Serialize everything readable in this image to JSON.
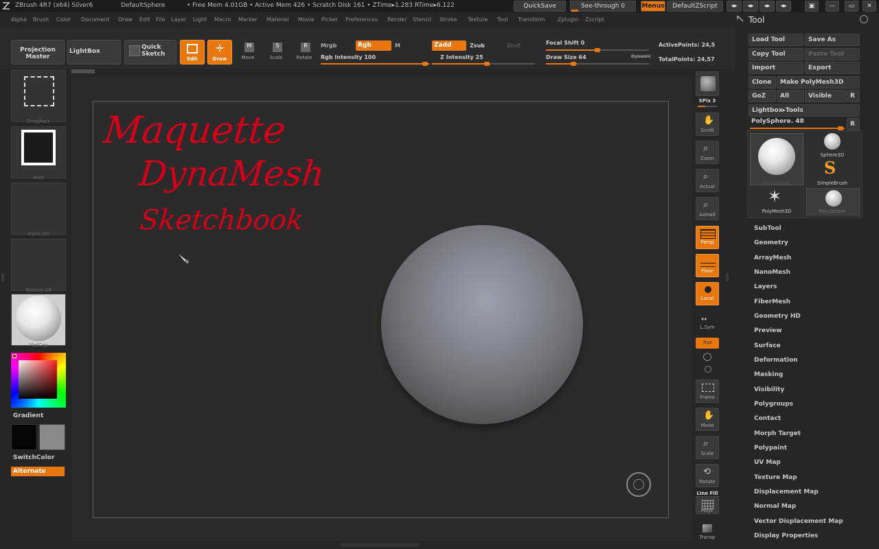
{
  "titlebar": {
    "app": "ZBrush 4R7 (x64) Silver6",
    "project": "DefaultSphere",
    "stats": "• Free Mem 4.01GB • Active Mem 426 • Scratch Disk 161 • ZTime▸1.283 RTime▸6.122",
    "quicksave": "QuickSave",
    "see_through": "See-through  0",
    "menus": "Menus",
    "default_zscript": "DefaultZScript"
  },
  "menus": [
    "Alpha",
    "Brush",
    "Color",
    "Document",
    "Draw",
    "Edit",
    "File",
    "Layer",
    "Light",
    "Macro",
    "Marker",
    "Material",
    "Movie",
    "Picker",
    "Preferences",
    "Render",
    "Stencil",
    "Stroke",
    "Texture",
    "Tool",
    "Transform",
    "Zplugin",
    "Zscript"
  ],
  "shelf": {
    "projection_master": "Projection Master",
    "lightbox": "LightBox",
    "quick_sketch": "Quick Sketch",
    "edit": "Edit",
    "draw": "Draw",
    "move": "Move",
    "scale": "Scale",
    "rotate": "Rotate",
    "mrgb": "Mrgb",
    "rgb": "Rgb",
    "m": "M",
    "rgb_intensity": "Rgb  Intensity 100",
    "zadd": "Zadd",
    "zsub": "Zsub",
    "zcut": "Zcut",
    "z_intensity": "Z  Intensity 25",
    "focal_shift": "Focal Shift 0",
    "draw_size": "Draw Size 64",
    "dynamic": "Dynamic",
    "active_points": "ActivePoints: 24,5",
    "total_points": "TotalPoints: 24,57"
  },
  "left": {
    "stroke_label": "DragRect",
    "alpha_label": "Rect",
    "alpha_off": "Alpha Off",
    "texture_off": "Texture Off",
    "material_label": "MatCap",
    "gradient": "Gradient",
    "switch_color": "SwitchColor",
    "alternate": "Alternate"
  },
  "canvas": {
    "annotation_line1": "Maquette",
    "annotation_line2": "DynaMesh",
    "annotation_line3": "Sketchbook"
  },
  "right": {
    "spix": "SPix 3",
    "scroll": "Scroll",
    "zoom": "Zoom",
    "actual": "Actual",
    "aahalf": "AAHalf",
    "persp": "Persp",
    "floor": "Floor",
    "local": "Local",
    "lsym": "L.Sym",
    "xyz": "Xyz",
    "frame": "Frame",
    "move": "Move",
    "scale": "Scale",
    "rotate": "Rotate",
    "linefill": "Line Fill",
    "polyf": "PolyF",
    "transp": "Transp"
  },
  "tool": {
    "title": "Tool",
    "load_tool": "Load Tool",
    "save_as": "Save As",
    "copy_tool": "Copy Tool",
    "paste_tool": "Paste Tool",
    "import": "Import",
    "export": "Export",
    "clone": "Clone",
    "make_polymesh": "Make PolyMesh3D",
    "goz": "GoZ",
    "all": "All",
    "visible": "Visible",
    "r": "R",
    "lightbox_tools": "Lightbox▸Tools",
    "current_tool": "PolySphere. 48",
    "thumbs": [
      "PolySphere",
      "Sphere3D",
      "SimpleBrush",
      "PolyMesh3D",
      "PolySphere"
    ],
    "subpalettes": [
      "SubTool",
      "Geometry",
      "ArrayMesh",
      "NanoMesh",
      "Layers",
      "FiberMesh",
      "Geometry HD",
      "Preview",
      "Surface",
      "Deformation",
      "Masking",
      "Visibility",
      "Polygroups",
      "Contact",
      "Morph Target",
      "Polypaint",
      "UV Map",
      "Texture Map",
      "Displacement Map",
      "Normal Map",
      "Vector Displacement Map",
      "Display Properties"
    ]
  },
  "colors": {
    "accent": "#e8770d",
    "annotation": "#d4001a"
  }
}
